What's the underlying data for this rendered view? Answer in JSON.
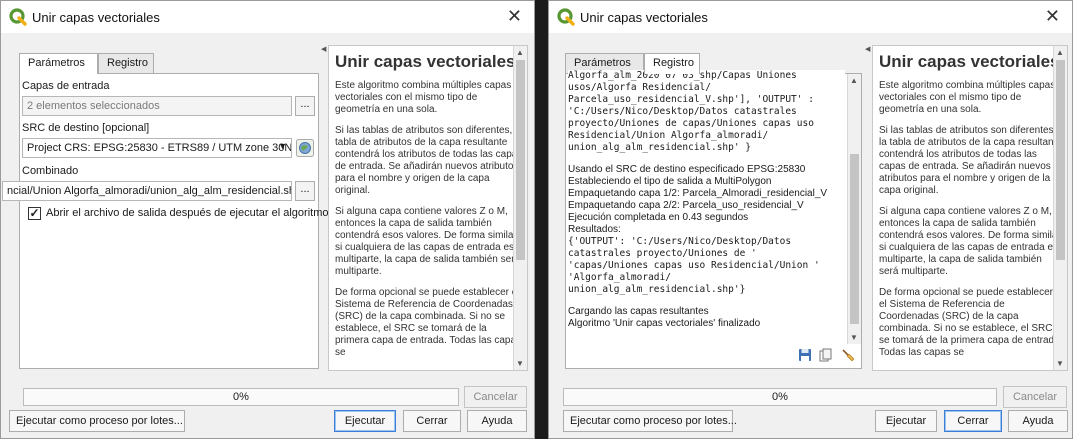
{
  "left": {
    "title": "Unir capas vectoriales",
    "tabs": [
      "Parámetros",
      "Registro"
    ],
    "params": {
      "input_layers_label": "Capas de entrada",
      "input_layers_value": "2 elementos seleccionados",
      "crs_label": "SRC de destino [opcional]",
      "crs_value": "Project CRS: EPSG:25830 - ETRS89 / UTM zone 30N",
      "output_label": "Combinado",
      "output_value": "ncial/Union Algorfa_almoradi/union_alg_alm_residencial.shp",
      "browse": "...",
      "open_output_label": "Abrir el archivo de salida después de ejecutar el algoritmo",
      "open_output_checked": "✓"
    },
    "progress": "0%",
    "buttons": {
      "cancel": "Cancelar",
      "batch": "Ejecutar como proceso por lotes...",
      "run": "Ejecutar",
      "close": "Cerrar",
      "help": "Ayuda"
    }
  },
  "help": {
    "title": "Unir capas vectoriales",
    "paragraphs": [
      "Este algoritmo combina múltiples capas vectoriales con el mismo tipo de geometría en una sola.",
      "Si las tablas de atributos son diferentes, la tabla de atributos de la capa resultante contendrá los atributos de todas las capas de entrada. Se añadirán nuevos atributos para el nombre y origen de la capa original.",
      "Si alguna capa contiene valores Z o M, entonces la capa de salida también contendrá esos valores. De forma similar, si cualquiera de las capas de entrada es multiparte, la capa de salida también será multiparte.",
      "De forma opcional se puede establecer el Sistema de Referencia de Coordenadas (SRC) de la capa combinada. Si no se establece, el SRC se tomará de la primera capa de entrada. Todas las capas se"
    ]
  },
  "right": {
    "title": "Unir capas vectoriales",
    "tabs": [
      "Parámetros",
      "Registro"
    ],
    "log": {
      "top_cut": "Algorfa_alm_2020 07 03_shp/Capas Uniones",
      "block1": [
        "usos/Algorfa Residencial/",
        "Parcela_uso_residencial_V.shp'], 'OUTPUT' :",
        "'C:/Users/Nico/Desktop/Datos catastrales",
        "proyecto/Uniones de capas/Uniones capas uso",
        "Residencial/Union Algorfa_almoradi/",
        "union_alg_alm_residencial.shp' }"
      ],
      "block2": [
        "Usando el SRC de destino especificado EPSG:25830",
        "Estableciendo el tipo de salida a MultiPolygon",
        "Empaquetando capa 1/2: Parcela_Almoradi_residencial_V",
        "Empaquetando capa 2/2: Parcela_uso_residencial_V",
        "Ejecución completada en 0.43 segundos",
        "Resultados:"
      ],
      "block3": [
        "{'OUTPUT': 'C:/Users/Nico/Desktop/Datos",
        "catastrales proyecto/Uniones de '",
        "'capas/Uniones capas uso Residencial/Union '",
        "'Algorfa_almoradi/",
        "union_alg_alm_residencial.shp'}"
      ],
      "block4": [
        "Cargando las capas resultantes",
        "Algoritmo 'Unir capas vectoriales' finalizado"
      ]
    },
    "progress": "0%",
    "buttons": {
      "cancel": "Cancelar",
      "batch": "Ejecutar como proceso por lotes...",
      "run": "Ejecutar",
      "close": "Cerrar",
      "help": "Ayuda"
    }
  },
  "icons": {
    "app": "qgis-logo-icon",
    "close": "close-icon",
    "crs": "crs-globe-icon",
    "save": "save-icon",
    "copy": "copy-icon",
    "clear": "broom-icon"
  },
  "colors": {
    "accent": "#3c7fd6",
    "qgis_green": "#589632",
    "qgis_yellow": "#eeb012"
  }
}
